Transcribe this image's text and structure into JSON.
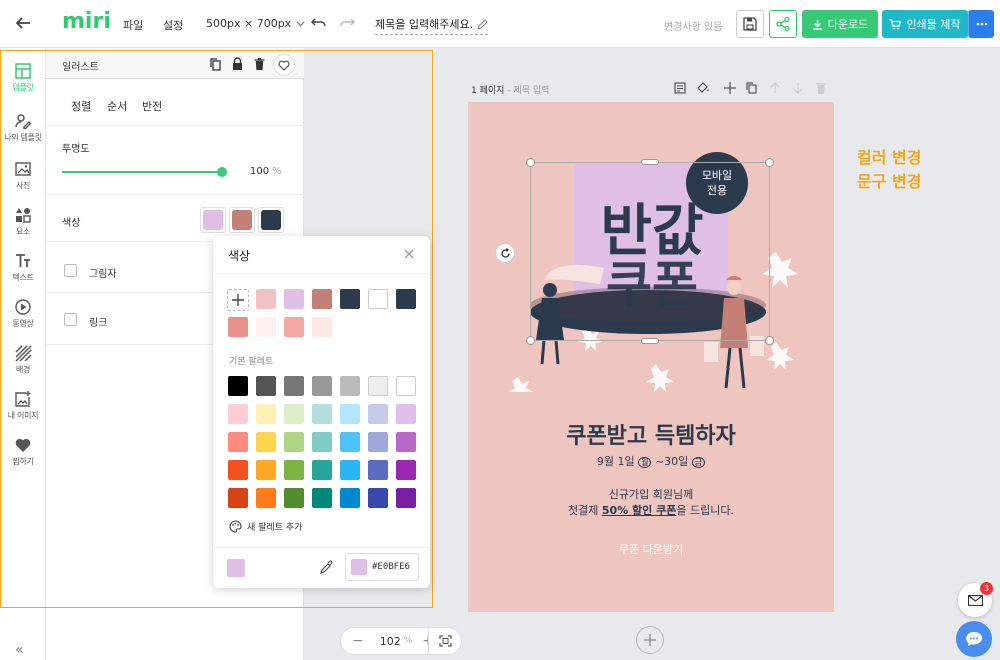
{
  "topbar": {
    "logo": "miri",
    "menu_file": "파일",
    "menu_settings": "설정",
    "page_size": "500px × 700px",
    "title_placeholder": "제목을 입력해주세요.",
    "status": "변경사항 있음",
    "download_label": "다운로드",
    "print_label": "인쇄물 제작"
  },
  "rail": {
    "items": [
      {
        "label": "템플릿",
        "icon": "template-icon"
      },
      {
        "label": "나의 템플릿",
        "icon": "my-template-icon"
      },
      {
        "label": "사진",
        "icon": "photo-icon"
      },
      {
        "label": "요소",
        "icon": "elements-icon"
      },
      {
        "label": "텍스트",
        "icon": "text-icon"
      },
      {
        "label": "동영상",
        "icon": "video-icon"
      },
      {
        "label": "배경",
        "icon": "background-icon"
      },
      {
        "label": "내 이미지",
        "icon": "my-image-icon"
      },
      {
        "label": "찜하기",
        "icon": "heart-icon"
      }
    ],
    "collapse": "«"
  },
  "panel": {
    "title": "일러스트",
    "tabs": [
      "정렬",
      "순서",
      "반전"
    ],
    "opacity_label": "투명도",
    "opacity_value": "100",
    "opacity_unit": "%",
    "opacity_fraction": 1.0,
    "color_label": "색상",
    "color_swatches": [
      "#e0bfe6",
      "#c47f76",
      "#2c3a4d"
    ],
    "shadow_label": "그림자",
    "link_label": "링크"
  },
  "color_popup": {
    "title": "색상",
    "recent_colors": [
      "#f2c1c1",
      "#e0bfe6",
      "#c47f76",
      "#2c3a4d",
      "#ffffff",
      "#2c3a4d",
      "#e8908a",
      "#fdf0ee",
      "#f2a9a3",
      "#fde9e3"
    ],
    "palette_label": "기본 팔레트",
    "palette": [
      [
        "#000000",
        "#555555",
        "#777777",
        "#999999",
        "#bbbbbb",
        "#eeeeee",
        "#ffffff"
      ],
      [
        "#ffcdd2",
        "#fff0b3",
        "#dcedc8",
        "#b2dfdb",
        "#b3e5fc",
        "#c5cae9",
        "#e1bee7"
      ],
      [
        "#ff8a80",
        "#ffd54f",
        "#aed581",
        "#80cbc4",
        "#4fc3f7",
        "#9fa8da",
        "#ba68c8"
      ],
      [
        "#f4511e",
        "#ffa726",
        "#7cb342",
        "#26a69a",
        "#29b6f6",
        "#5c6bc0",
        "#9c27b0"
      ],
      [
        "#d84315",
        "#ff7a1a",
        "#558b2f",
        "#00897b",
        "#0288d1",
        "#3949ab",
        "#7b1fa2"
      ]
    ],
    "add_palette_label": "새 팔레트 추가",
    "current_color": "#e0bfe6",
    "hex_value": "#E0BFE6"
  },
  "page_header": {
    "label": "1 페이지",
    "title_placeholder": "제목 입력"
  },
  "design": {
    "badge_line1": "모바일",
    "badge_line2": "전용",
    "big_line1": "반값",
    "big_line2": "쿠폰",
    "headline": "쿠폰받고 득템하자",
    "date_prefix": "9월 1일",
    "date_day1": "월",
    "date_mid": "~30일",
    "date_day2": "금",
    "body_line1": "신규가입 회원님께",
    "body_line2_a": "첫결제 ",
    "body_line2_b": "50% 할인 쿠폰",
    "body_line2_c": "을 드립니다.",
    "cta": "쿠폰 다운받기"
  },
  "annotation": {
    "line1": "컬러 변경",
    "line2": "문구 변경"
  },
  "zoom": {
    "value": "102",
    "unit": "%"
  },
  "notifications": {
    "count": "3"
  },
  "colors": {
    "brand_green": "#2ecc71",
    "download_green": "#37c978",
    "print_teal": "#1fb8c8",
    "more_blue": "#2b7de9",
    "accent_orange": "#f3a81c",
    "navy": "#2c3a4d"
  }
}
